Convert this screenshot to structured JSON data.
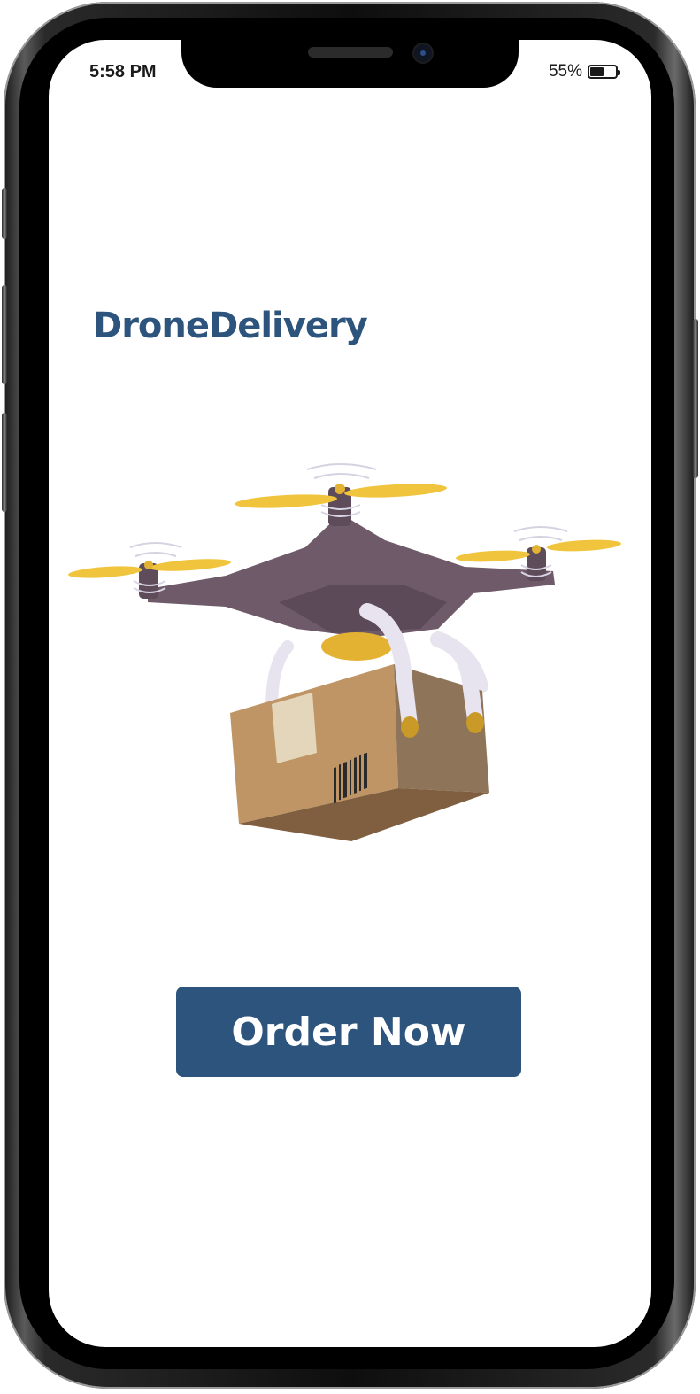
{
  "status_bar": {
    "time": "5:58 PM",
    "battery_percent_label": "55%",
    "battery_level": 0.55
  },
  "app": {
    "brand_title": "DroneDelivery",
    "order_button_label": "Order Now"
  },
  "illustration": {
    "icon": "drone-delivery-illustration",
    "colors": {
      "drone_body": "#6e5a68",
      "propeller": "#f0c43c",
      "box_front": "#c09565",
      "box_side": "#8e7458",
      "legs": "#e7e4ef"
    }
  },
  "colors": {
    "brand": "#2d547c",
    "button_text": "#ffffff",
    "screen_bg": "#ffffff"
  }
}
